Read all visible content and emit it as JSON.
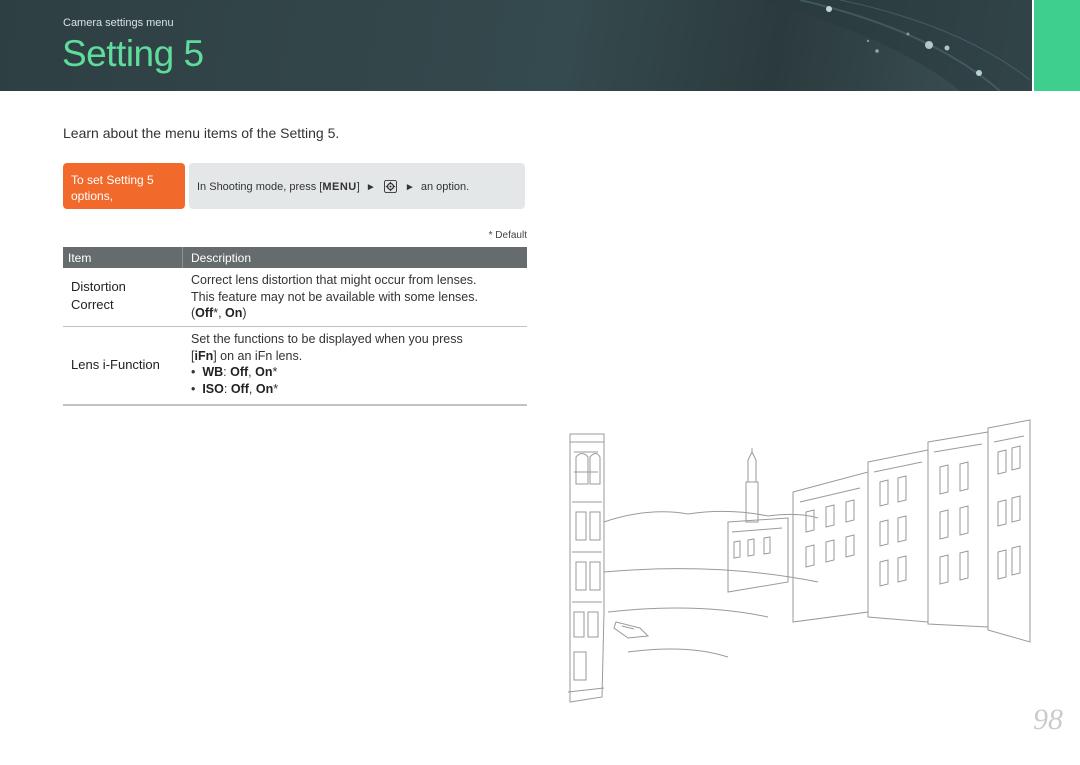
{
  "header": {
    "breadcrumb": "Camera settings menu",
    "title": "Setting 5"
  },
  "intro": "Learn about the menu items of the Setting 5.",
  "howto": {
    "label": "To set Setting 5 options,",
    "instruction_prefix": "In Shooting mode, press [",
    "menu_key": "MENU",
    "instruction_mid": "]",
    "instruction_suffix": "an option.",
    "arrow": "►",
    "icon": "settings-gear-icon"
  },
  "default_note": "* Default",
  "table": {
    "headers": [
      "Item",
      "Description"
    ],
    "rows": [
      {
        "item_line1": "Distortion",
        "item_line2": "Correct",
        "desc_line1": "Correct lens distortion that might occur from lenses.",
        "desc_line2": "This feature may not be available with some lenses.",
        "opt_open": "(",
        "opt1": "Off",
        "opt1_mark": "*, ",
        "opt2": "On",
        "opt_close": ")"
      },
      {
        "item": "Lens i-Function",
        "desc_line1": "Set the functions to be displayed when you press",
        "desc_line2_key": "iFn",
        "desc_line2_rest": "] on an iFn lens.",
        "desc_line2_open": "[",
        "bullets": [
          {
            "name": "WB",
            "sep": ": ",
            "v1": "Off",
            "comma": ", ",
            "v2": "On",
            "mark": "*"
          },
          {
            "name": "ISO",
            "sep": ": ",
            "v1": "Off",
            "comma": ", ",
            "v2": "On",
            "mark": "*"
          }
        ]
      }
    ]
  },
  "page_number": "98",
  "colors": {
    "header_bg": "#33474b",
    "title_green": "#5fdc9c",
    "side_tab_green": "#3ecf8e",
    "howto_orange": "#f26a2b",
    "table_header": "#666b6d"
  }
}
